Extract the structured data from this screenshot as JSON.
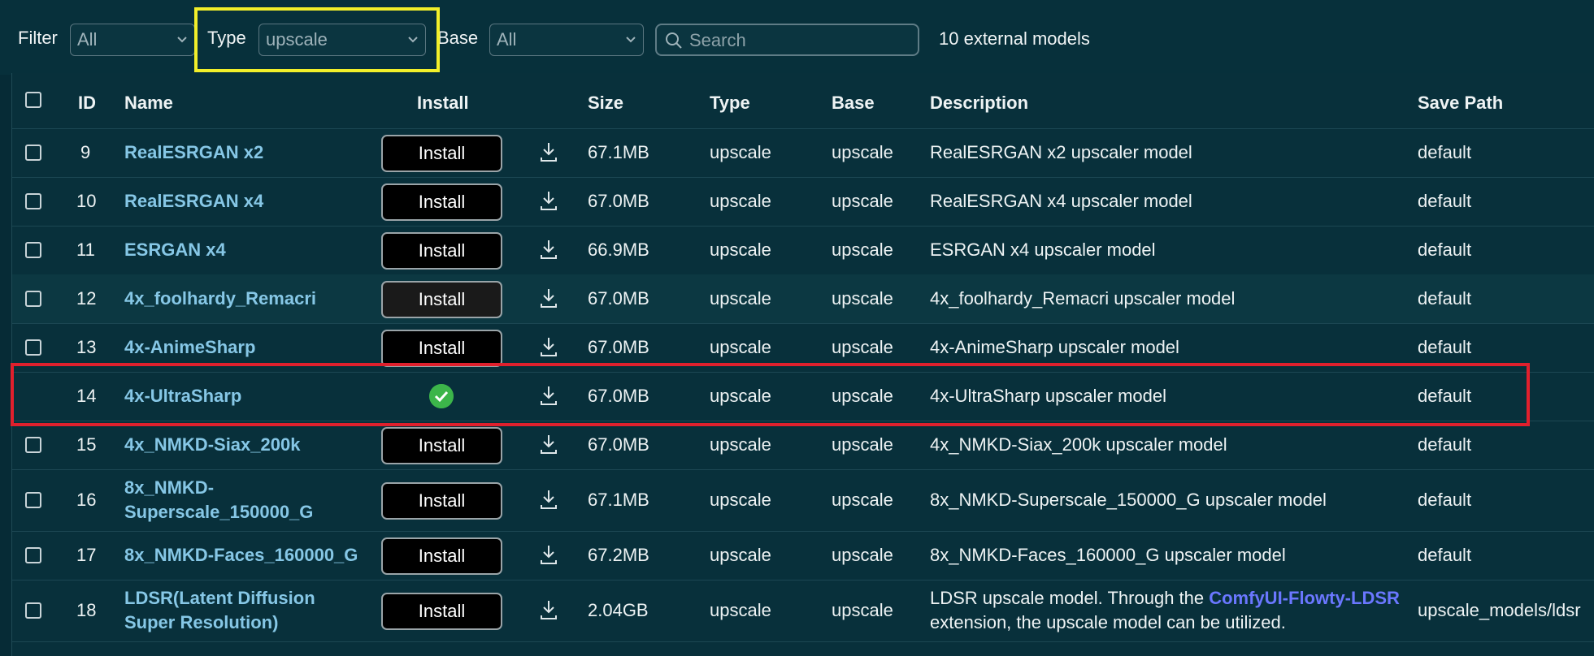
{
  "toolbar": {
    "filter_label": "Filter",
    "filter_value": "All",
    "type_label": "Type",
    "type_value": "upscale",
    "base_label": "Base",
    "base_value": "All",
    "search_placeholder": "Search",
    "count_text": "10 external models"
  },
  "columns": {
    "id": "ID",
    "name": "Name",
    "install": "Install",
    "size": "Size",
    "type": "Type",
    "base": "Base",
    "description": "Description",
    "save_path": "Save Path"
  },
  "install_label": "Install",
  "rows": [
    {
      "id": "9",
      "name": "RealESRGAN x2",
      "size": "67.1MB",
      "type": "upscale",
      "base": "upscale",
      "desc": "RealESRGAN x2 upscaler model",
      "path": "default"
    },
    {
      "id": "10",
      "name": "RealESRGAN x4",
      "size": "67.0MB",
      "type": "upscale",
      "base": "upscale",
      "desc": "RealESRGAN x4 upscaler model",
      "path": "default"
    },
    {
      "id": "11",
      "name": "ESRGAN x4",
      "size": "66.9MB",
      "type": "upscale",
      "base": "upscale",
      "desc": "ESRGAN x4 upscaler model",
      "path": "default"
    },
    {
      "id": "12",
      "name": "4x_foolhardy_Remacri",
      "size": "67.0MB",
      "type": "upscale",
      "base": "upscale",
      "desc": "4x_foolhardy_Remacri upscaler model",
      "path": "default"
    },
    {
      "id": "13",
      "name": "4x-AnimeSharp",
      "size": "67.0MB",
      "type": "upscale",
      "base": "upscale",
      "desc": "4x-AnimeSharp upscaler model",
      "path": "default"
    },
    {
      "id": "14",
      "name": "4x-UltraSharp",
      "size": "67.0MB",
      "type": "upscale",
      "base": "upscale",
      "desc": "4x-UltraSharp upscaler model",
      "path": "default",
      "installed": true
    },
    {
      "id": "15",
      "name": "4x_NMKD-Siax_200k",
      "size": "67.0MB",
      "type": "upscale",
      "base": "upscale",
      "desc": "4x_NMKD-Siax_200k upscaler model",
      "path": "default"
    },
    {
      "id": "16",
      "name_l1": "8x_NMKD-",
      "name_l2": "Superscale_150000_G",
      "size": "67.1MB",
      "type": "upscale",
      "base": "upscale",
      "desc": "8x_NMKD-Superscale_150000_G upscaler model",
      "path": "default"
    },
    {
      "id": "17",
      "name": "8x_NMKD-Faces_160000_G",
      "size": "67.2MB",
      "type": "upscale",
      "base": "upscale",
      "desc": "8x_NMKD-Faces_160000_G upscaler model",
      "path": "default"
    },
    {
      "id": "18",
      "name_l1": "LDSR(Latent Diffusion",
      "name_l2": "Super Resolution)",
      "size": "2.04GB",
      "type": "upscale",
      "base": "upscale",
      "desc_l1_pre": "LDSR upscale model. Through the ",
      "desc_l1_link": "ComfyUI-Flowty-LDSR",
      "desc_l2": "extension, the upscale model can be utilized.",
      "path": "upscale_models/ldsr"
    }
  ],
  "colors": {
    "background": "#062b36",
    "name_link": "#86c7e6",
    "desc_link": "#6a77ff",
    "installed_check": "#3cb54a",
    "highlight_yellow": "#f2ef2a",
    "highlight_red": "#e0202d"
  }
}
